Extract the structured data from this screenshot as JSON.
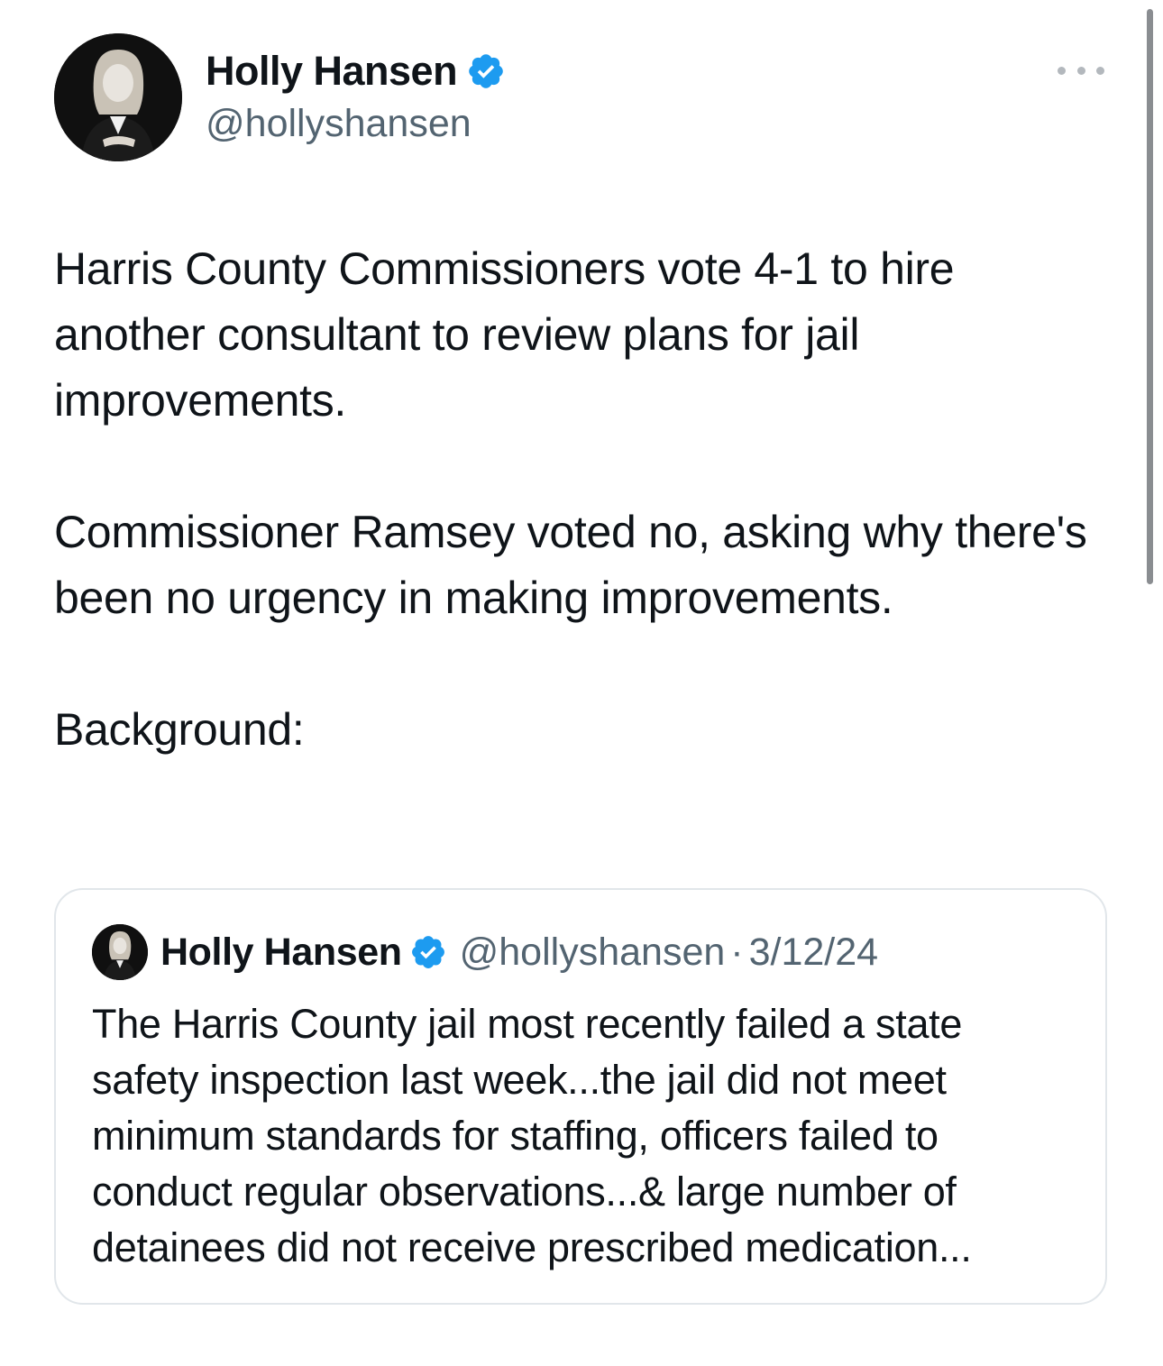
{
  "author": {
    "display_name": "Holly Hansen",
    "handle": "@hollyshansen",
    "verified_icon": "verified-badge-icon"
  },
  "menu": {
    "more_icon": "more-horizontal-icon"
  },
  "tweet": {
    "paragraphs": [
      "Harris County Commissioners vote 4-1 to hire another consultant to review plans for jail improvements.",
      "Commissioner Ramsey voted no, asking why there's been no urgency in making improvements.",
      "Background:"
    ]
  },
  "quoted_tweet": {
    "display_name": "Holly Hansen",
    "handle": "@hollyshansen",
    "separator": "·",
    "date": "3/12/24",
    "text": "The Harris County jail most recently failed a state safety inspection last week...the jail did not meet minimum standards for staffing, officers failed to conduct regular observations...& large number of detainees did not receive prescribed medication..."
  },
  "colors": {
    "verified_blue": "#1d9bf0",
    "secondary_text": "#536471",
    "border": "#e1e6ea"
  }
}
